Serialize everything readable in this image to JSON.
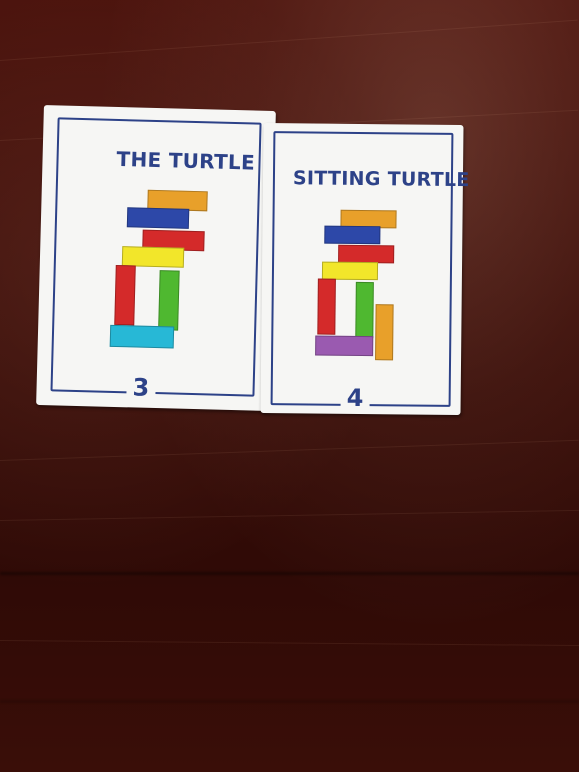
{
  "cards": [
    {
      "title": "THE TURTLE",
      "number": "3"
    },
    {
      "title": "SITTING TURTLE",
      "number": "4"
    }
  ],
  "colors": {
    "card_ink": "#2d4288",
    "table_wood": "#3f100a",
    "block_orange": "#e8a02a",
    "block_blue": "#2d48a8",
    "block_red": "#d42a2a",
    "block_yellow": "#f2e62a",
    "block_green": "#4fb830",
    "block_cyan": "#27b8d6",
    "block_purple": "#9a5ab0"
  }
}
